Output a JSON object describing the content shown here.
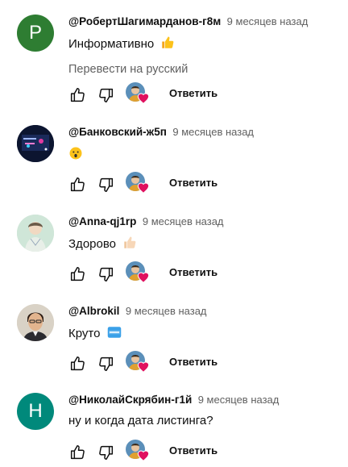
{
  "colors": {
    "author": "#0f0f0f",
    "meta": "#606060",
    "heart": "#e0115f",
    "avatar_p": "#2e7d32",
    "avatar_h": "#00897b"
  },
  "comments": [
    {
      "author": "@РобертШагимарданов-г8м",
      "time": "9 месяцев назад",
      "text": "Информативно",
      "emoji": "thumbs-up",
      "translate": "Перевести на русский",
      "avatar_letter": "P",
      "reply": "Ответить"
    },
    {
      "author": "@Банковский-ж5п",
      "time": "9 месяцев назад",
      "text": "",
      "emoji": "astonished-face",
      "reply": "Ответить"
    },
    {
      "author": "@Anna-qj1rp",
      "time": "9 месяцев назад",
      "text": "Здорово",
      "emoji": "thumbs-up-light",
      "reply": "Ответить"
    },
    {
      "author": "@Albrokil",
      "time": "9 месяцев назад",
      "text": "Круто",
      "emoji": "cool-button",
      "reply": "Ответить"
    },
    {
      "author": "@НиколайСкрябин-г1й",
      "time": "9 месяцев назад",
      "text": "ну и когда дата листинга?",
      "avatar_letter": "H",
      "reply": "Ответить"
    }
  ]
}
